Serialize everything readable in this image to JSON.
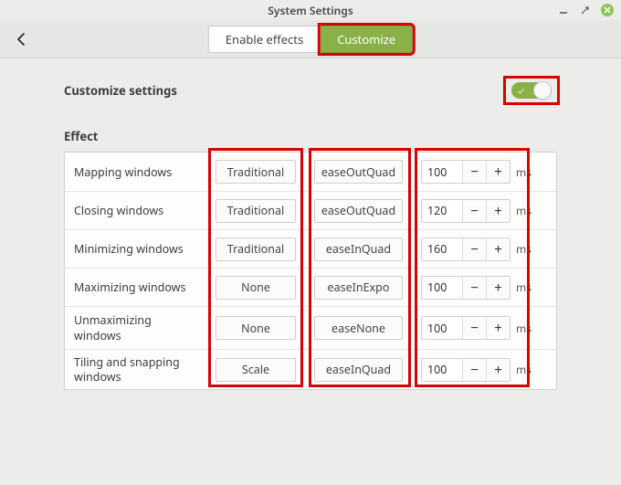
{
  "window": {
    "title": "System Settings"
  },
  "tabs": {
    "enable": "Enable effects",
    "customize": "Customize",
    "active_index": 1
  },
  "settings": {
    "toggle_label": "Customize settings",
    "toggle_on": true,
    "section": "Effect",
    "ms_unit": "ms",
    "rows": [
      {
        "label": "Mapping windows",
        "style": "Traditional",
        "easing": "easeOutQuad",
        "ms": "100"
      },
      {
        "label": "Closing windows",
        "style": "Traditional",
        "easing": "easeOutQuad",
        "ms": "120"
      },
      {
        "label": "Minimizing windows",
        "style": "Traditional",
        "easing": "easeInQuad",
        "ms": "160"
      },
      {
        "label": "Maximizing windows",
        "style": "None",
        "easing": "easeInExpo",
        "ms": "100"
      },
      {
        "label": "Unmaximizing windows",
        "style": "None",
        "easing": "easeNone",
        "ms": "100"
      },
      {
        "label": "Tiling and snapping windows",
        "style": "Scale",
        "easing": "easeInQuad",
        "ms": "100"
      }
    ]
  },
  "icons": {
    "minus": "−",
    "plus": "+"
  }
}
